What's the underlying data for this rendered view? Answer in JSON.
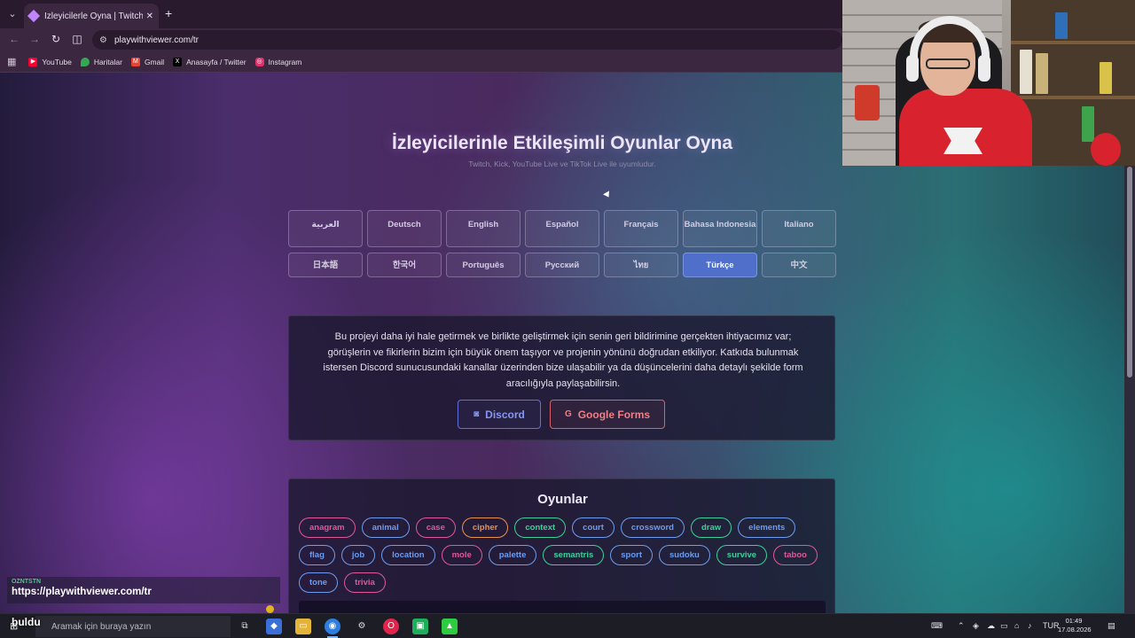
{
  "browser": {
    "tab_title": "İzleyicilerle Oyna | Twitch, Kick,",
    "tab_close_icon": "close-icon",
    "new_tab_label": "+",
    "url": "playwithviewer.com/tr",
    "bookmarks": [
      {
        "label": "YouTube",
        "color": "#ff0033"
      },
      {
        "label": "Haritalar",
        "color": "#34a853"
      },
      {
        "label": "Gmail",
        "color": "#ea4335"
      },
      {
        "label": "Anasayfa / Twitter",
        "color": "#000000"
      },
      {
        "label": "Instagram",
        "color": "#e1306c"
      }
    ]
  },
  "page": {
    "title": "İzleyicilerinle Etkileşimli Oyunlar Oyna",
    "subtitle": "Twitch, Kick, YouTube Live ve TikTok Live ile uyumludur.",
    "languages": [
      "العربية",
      "Deutsch",
      "English",
      "Español",
      "Français",
      "Bahasa Indonesia",
      "Italiano",
      "日本語",
      "한국어",
      "Português",
      "Русский",
      "ไทย",
      "Türkçe",
      "中文"
    ],
    "selected_language": "Türkçe",
    "feedback": {
      "text": "Bu projeyi daha iyi hale getirmek ve birlikte geliştirmek için senin geri bildirimine gerçekten ihtiyacımız var; görüşlerin ve fikirlerin bizim için büyük önem taşıyor ve projenin yönünü doğrudan etkiliyor. Katkıda bulunmak istersen Discord sunucusundaki kanallar üzerinden bize ulaşabilir ya da düşüncelerini daha detaylı şekilde form aracılığıyla paylaşabilirsin.",
      "discord_label": "Discord",
      "gforms_label": "Google Forms"
    },
    "games": {
      "title": "Oyunlar",
      "items": [
        {
          "name": "anagram",
          "color": "#e0589a"
        },
        {
          "name": "animal",
          "color": "#6d9cf0"
        },
        {
          "name": "case",
          "color": "#e0589a"
        },
        {
          "name": "cipher",
          "color": "#e8924a"
        },
        {
          "name": "context",
          "color": "#3ecf9a"
        },
        {
          "name": "court",
          "color": "#6d9cf0"
        },
        {
          "name": "crossword",
          "color": "#6d9cf0"
        },
        {
          "name": "draw",
          "color": "#3ecf9a"
        },
        {
          "name": "elements",
          "color": "#6d9cf0"
        },
        {
          "name": "flag",
          "color": "#6d9cf0"
        },
        {
          "name": "job",
          "color": "#6d9cf0"
        },
        {
          "name": "location",
          "color": "#6d9cf0"
        },
        {
          "name": "mole",
          "color": "#e0589a"
        },
        {
          "name": "palette",
          "color": "#6d9cf0"
        },
        {
          "name": "semantris",
          "color": "#3ecf9a"
        },
        {
          "name": "sport",
          "color": "#6d9cf0"
        },
        {
          "name": "sudoku",
          "color": "#6d9cf0"
        },
        {
          "name": "survive",
          "color": "#3ecf9a"
        },
        {
          "name": "taboo",
          "color": "#e0589a"
        },
        {
          "name": "tone",
          "color": "#6d9cf0"
        },
        {
          "name": "trivia",
          "color": "#e0589a"
        }
      ]
    }
  },
  "chat": {
    "user": "OZNTSTN",
    "message": "https://playwithviewer.com/tr",
    "overlay_word": "buldu"
  },
  "taskbar": {
    "search_placeholder": "Aramak için buraya yazın",
    "language": "TUR",
    "time": "01:49",
    "date": "17.08.2026"
  }
}
